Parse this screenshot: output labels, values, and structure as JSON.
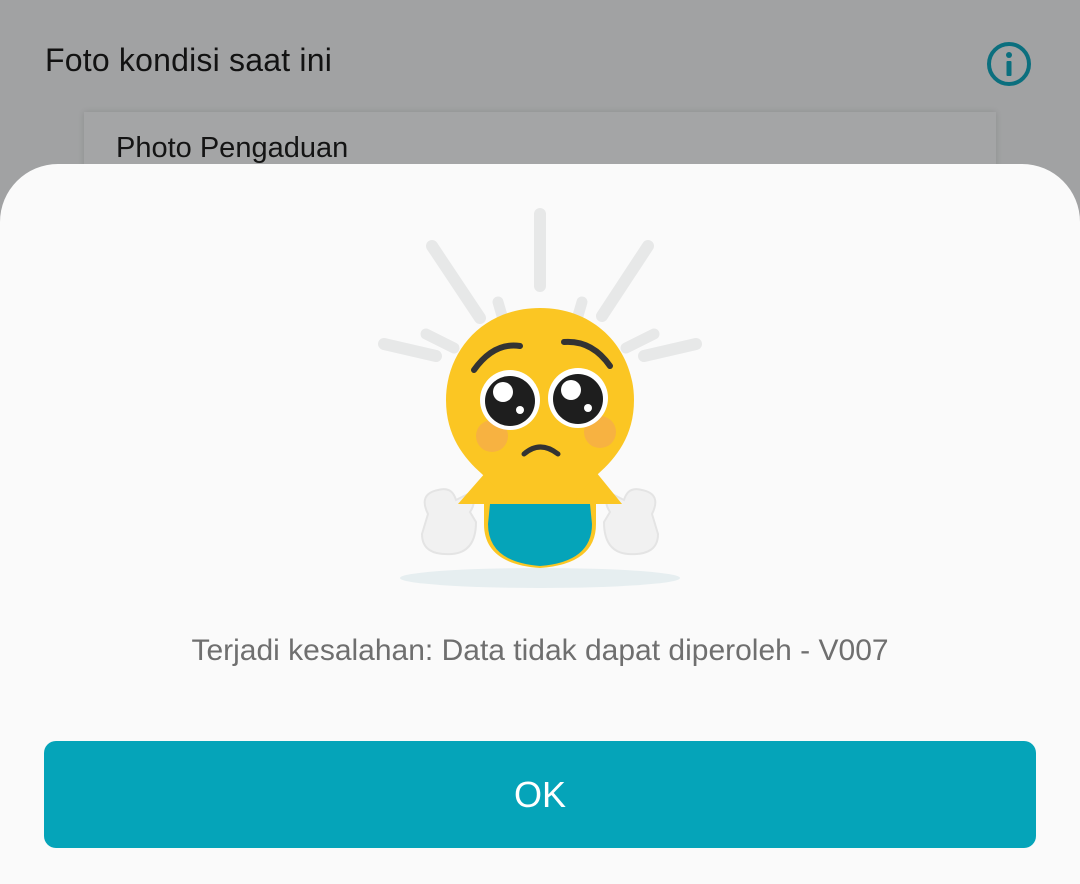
{
  "background_page": {
    "title": "Foto kondisi saat ini",
    "info_icon": "info-circle-icon",
    "card_label": "Photo Pengaduan"
  },
  "dialog": {
    "illustration": "sad-lightbulb-mascot",
    "message": "Terjadi kesalahan: Data tidak dapat diperoleh - V007",
    "ok_label": "OK"
  },
  "colors": {
    "accent": "#05a4b9",
    "overlay": "#a1a2a3",
    "sheet": "#fafafa",
    "message_text": "#6f6f6f",
    "mascot_yellow": "#fbc623",
    "mascot_shirt": "#05a4b9"
  }
}
